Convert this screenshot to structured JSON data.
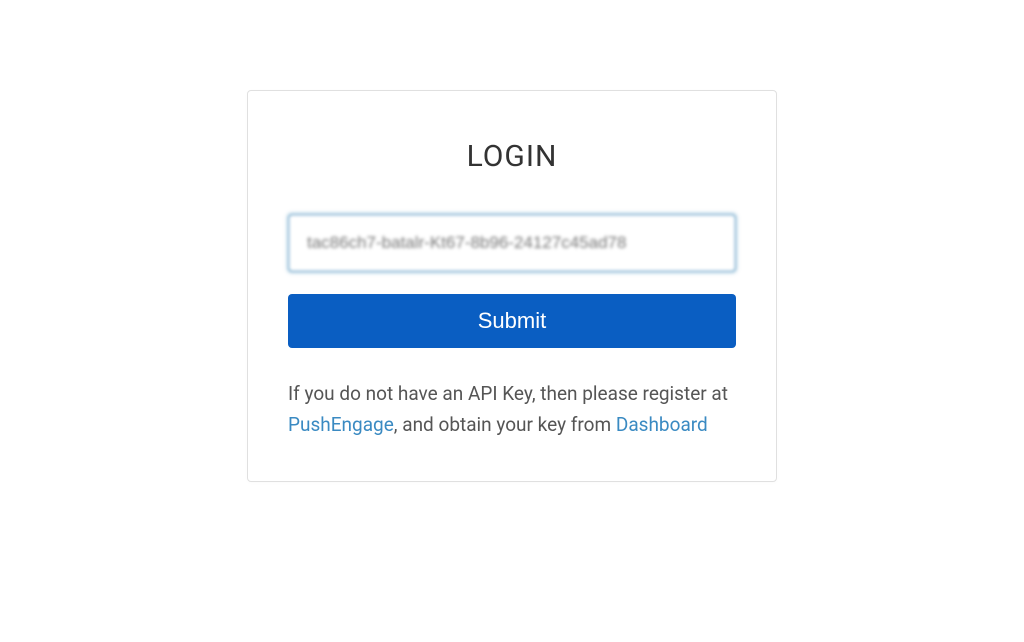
{
  "login": {
    "title": "LOGIN",
    "api_key_value": "tac86ch7-batalr-Kt67-8b96-24127c45ad78",
    "submit_label": "Submit",
    "help_prefix": "If you do not have an API Key, then please register at ",
    "link1_label": "PushEngage",
    "help_mid": ", and obtain your key from ",
    "link2_label": "Dashboard"
  }
}
